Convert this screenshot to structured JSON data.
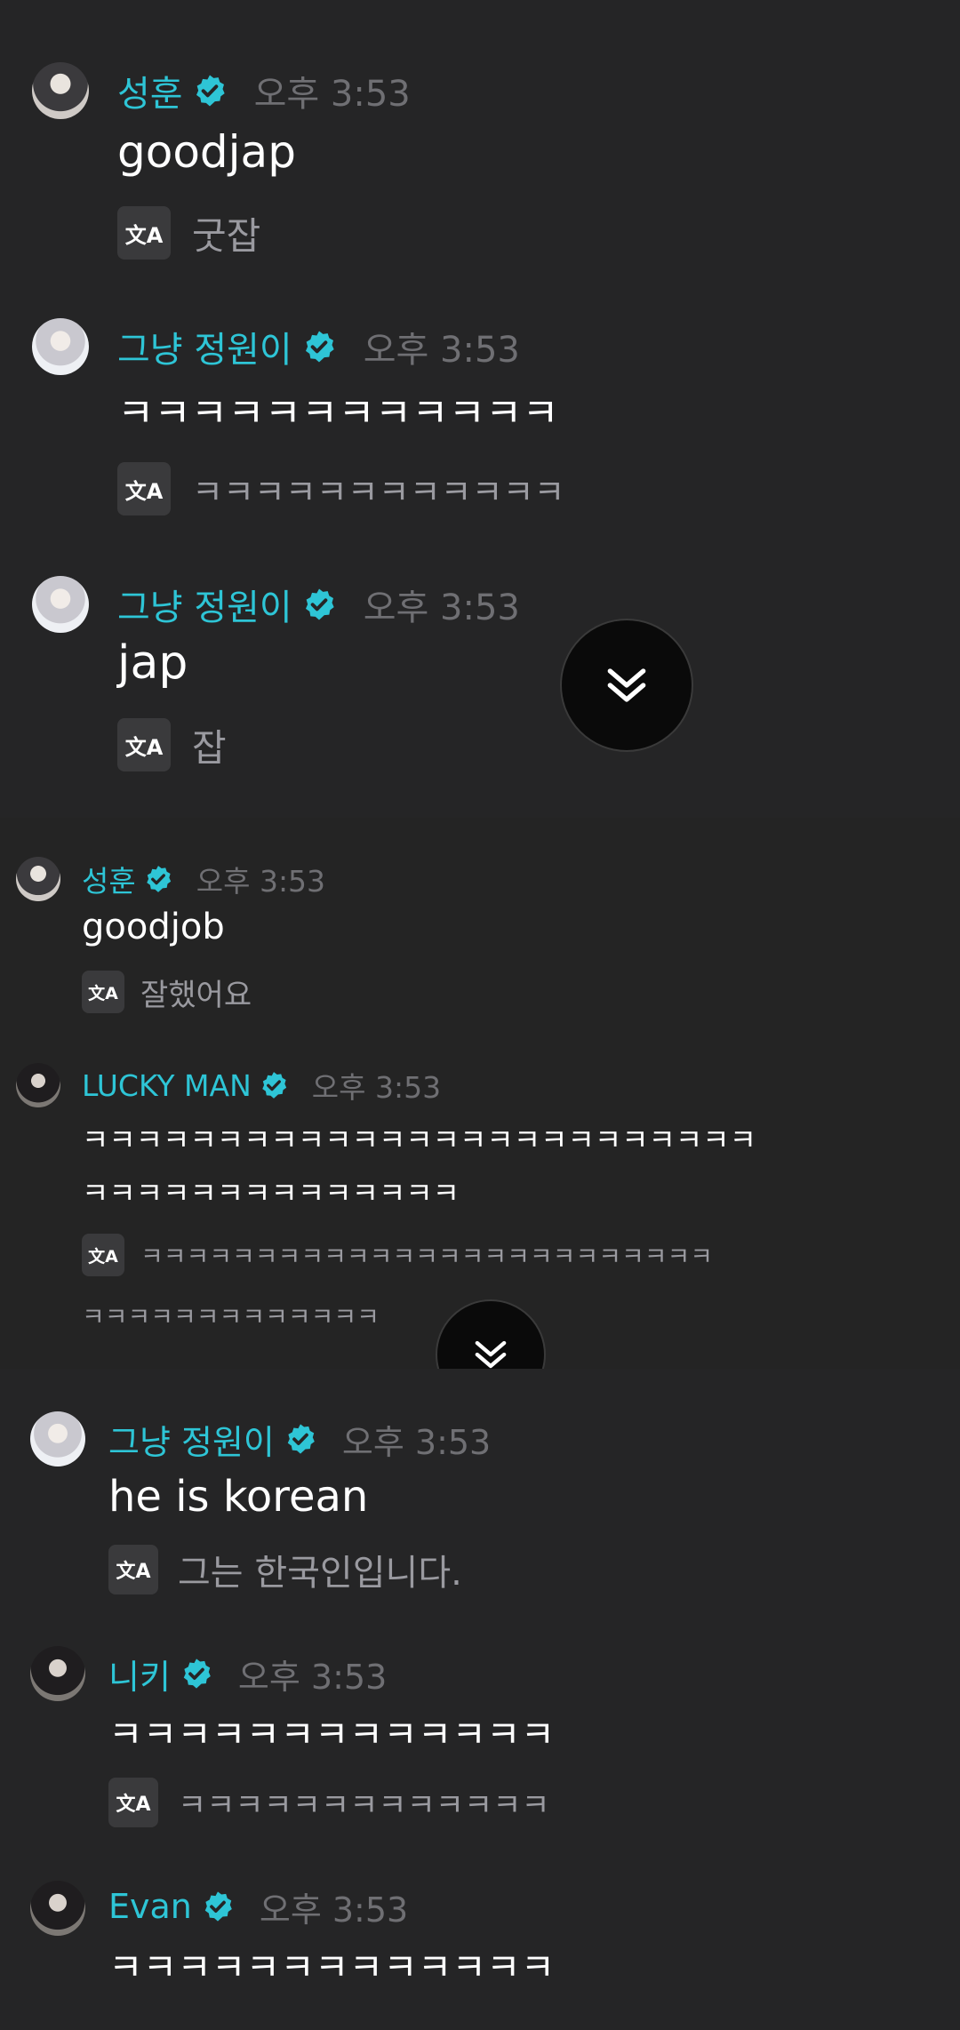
{
  "time_label": "오후 3:53",
  "translate_icon": "translate-icon",
  "scroll_icon": "chevrons-down-icon",
  "colors": {
    "background": "#252526",
    "name": "#2ec5d6",
    "verified": "#2ec5d6",
    "time": "#6f6f73",
    "translation": "#9a9aa0"
  },
  "panel1": [
    {
      "author": "성훈",
      "time": "오후 3:53",
      "text": "goodjap",
      "translation": "굿잡"
    },
    {
      "author": "그냥 정원이",
      "time": "오후 3:53",
      "text": "ㅋㅋㅋㅋㅋㅋㅋㅋㅋㅋㅋㅋ",
      "translation": "ㅋㅋㅋㅋㅋㅋㅋㅋㅋㅋㅋㅋ"
    },
    {
      "author": "그냥 정원이",
      "time": "오후 3:53",
      "text": "jap",
      "translation": "잡"
    }
  ],
  "panel2": [
    {
      "author": "성훈",
      "time": "오후 3:53",
      "text": "goodjob",
      "translation": "잘했어요"
    },
    {
      "author": "LUCKY MAN",
      "time": "오후 3:53",
      "text_line1": "ㅋㅋㅋㅋㅋㅋㅋㅋㅋㅋㅋㅋㅋㅋㅋㅋㅋㅋㅋㅋㅋㅋㅋㅋㅋ",
      "text_line2": "ㅋㅋㅋㅋㅋㅋㅋㅋㅋㅋㅋㅋㅋㅋ",
      "translation_line1": "ㅋㅋㅋㅋㅋㅋㅋㅋㅋㅋㅋㅋㅋㅋㅋㅋㅋㅋㅋㅋㅋㅋㅋㅋㅋ",
      "translation_line2": "ㅋㅋㅋㅋㅋㅋㅋㅋㅋㅋㅋㅋㅋ"
    }
  ],
  "panel3": [
    {
      "author": "그냥 정원이",
      "time": "오후 3:53",
      "text": "he is korean",
      "translation": "그는 한국인입니다."
    },
    {
      "author": "니키",
      "time": "오후 3:53",
      "text": "ㅋㅋㅋㅋㅋㅋㅋㅋㅋㅋㅋㅋㅋ",
      "translation": "ㅋㅋㅋㅋㅋㅋㅋㅋㅋㅋㅋㅋㅋ"
    },
    {
      "author": "Evan",
      "time": "오후 3:53",
      "text": "ㅋㅋㅋㅋㅋㅋㅋㅋㅋㅋㅋㅋㅋ"
    }
  ]
}
